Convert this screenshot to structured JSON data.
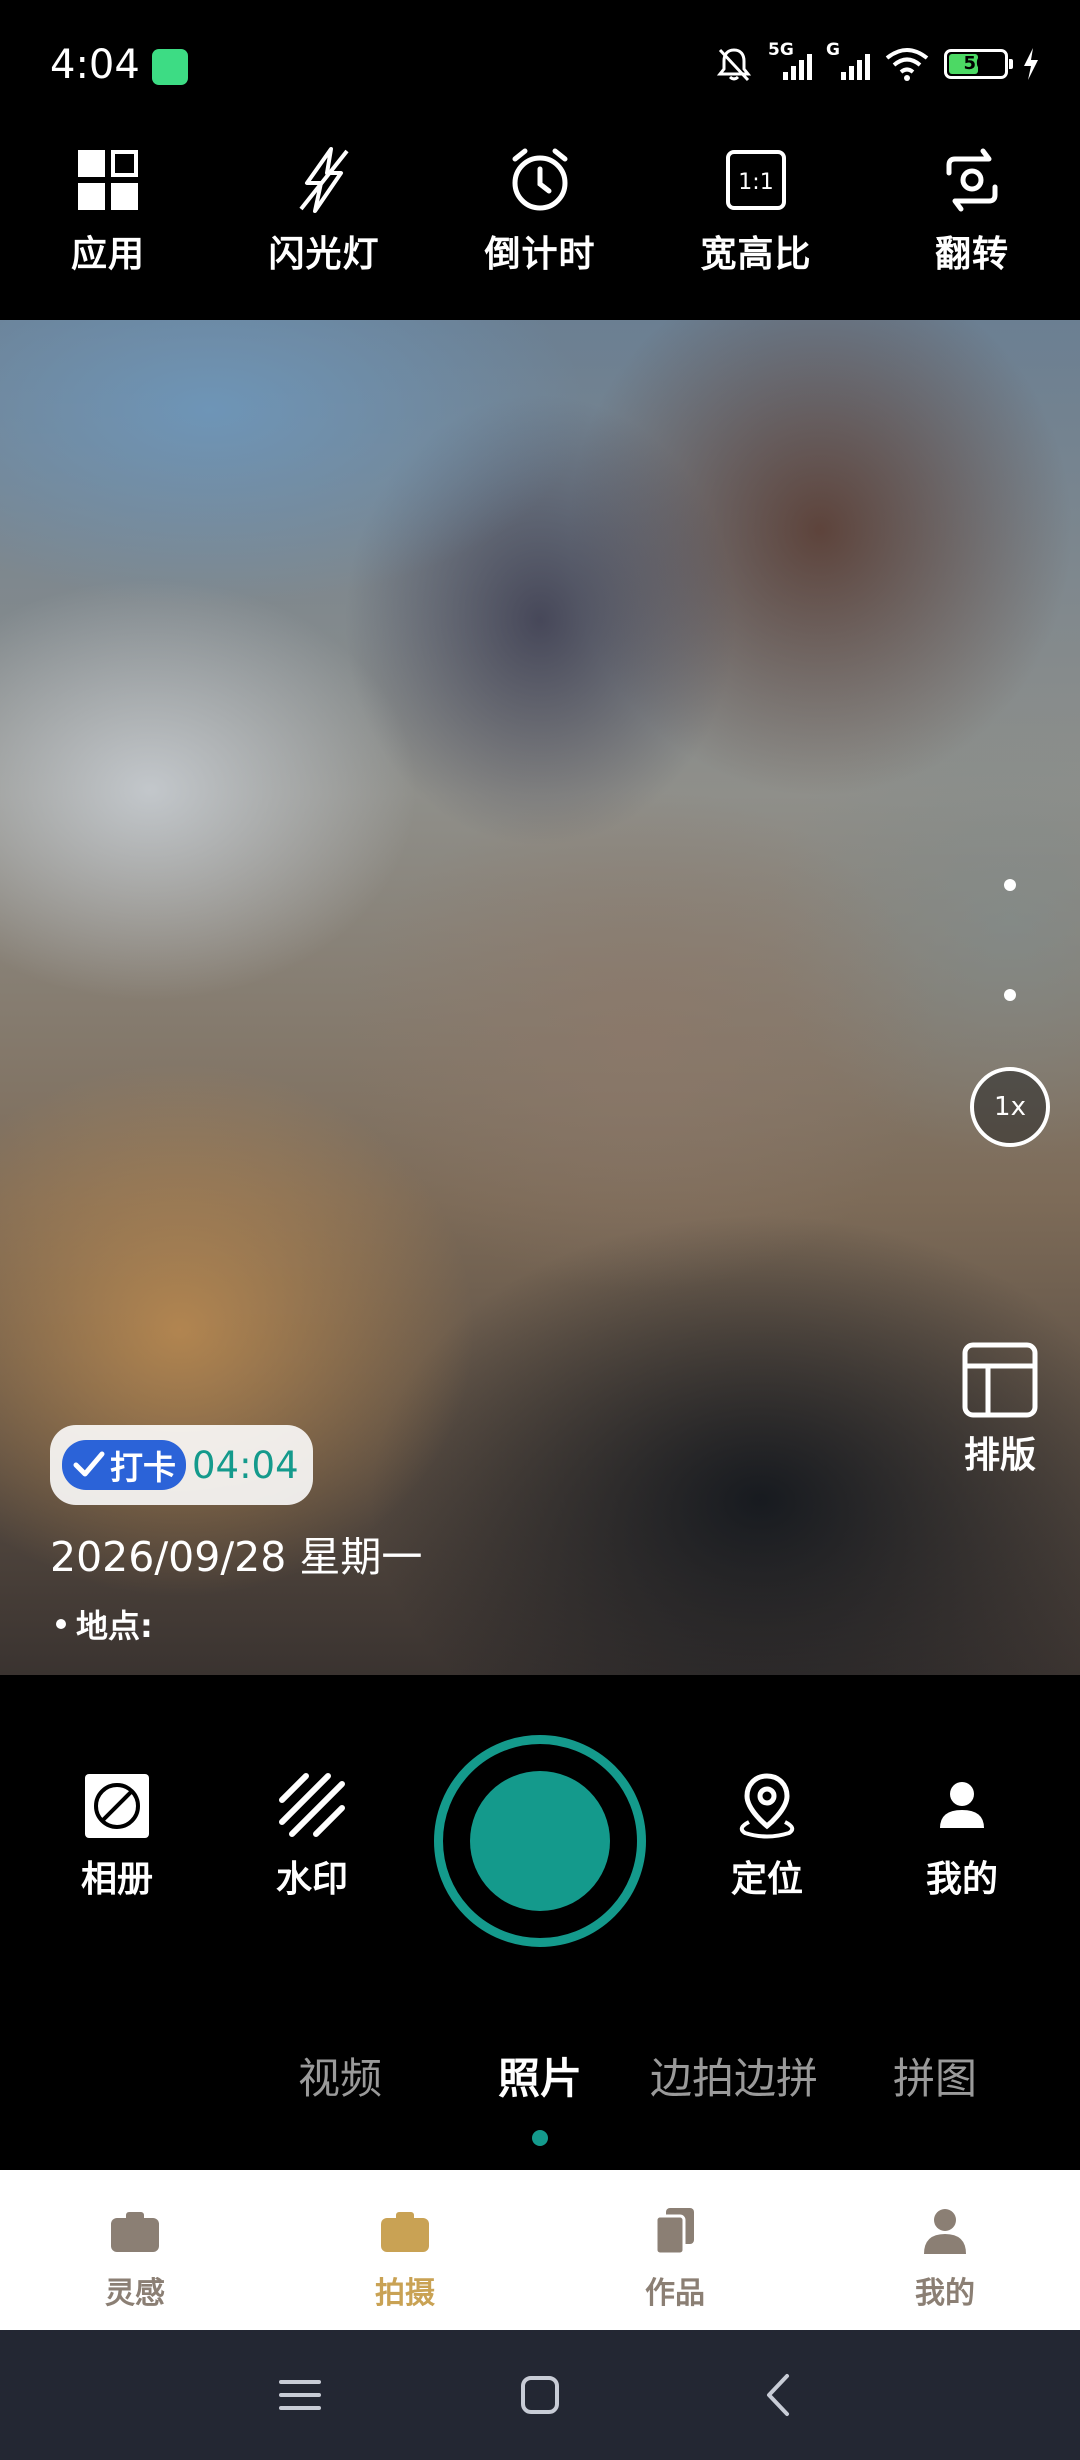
{
  "status_bar": {
    "time": "4:04",
    "signal1_label": "5G",
    "signal2_label": "G",
    "battery": "50"
  },
  "top_toolbar": {
    "apps": "应用",
    "flash": "闪光灯",
    "timer": "倒计时",
    "aspect": "宽高比",
    "aspect_icon_text": "1:1",
    "flip": "翻转"
  },
  "viewfinder": {
    "zoom": "1x",
    "layout": "排版",
    "watermark": {
      "checkin": "打卡",
      "time": "04:04",
      "date": "2026/09/28 星期一",
      "location": "地点:"
    }
  },
  "controls": {
    "album": "相册",
    "watermark": "水印",
    "locate": "定位",
    "mine": "我的"
  },
  "modes": [
    "视频",
    "照片",
    "边拍边拼",
    "拼图"
  ],
  "active_mode": "照片",
  "bottom_nav": {
    "inspiration": "灵感",
    "shoot": "拍摄",
    "works": "作品",
    "mine": "我的"
  },
  "colors": {
    "accent": "#149a8c",
    "nav_active": "#c9a254",
    "checkin_blue": "#2b63d8"
  }
}
